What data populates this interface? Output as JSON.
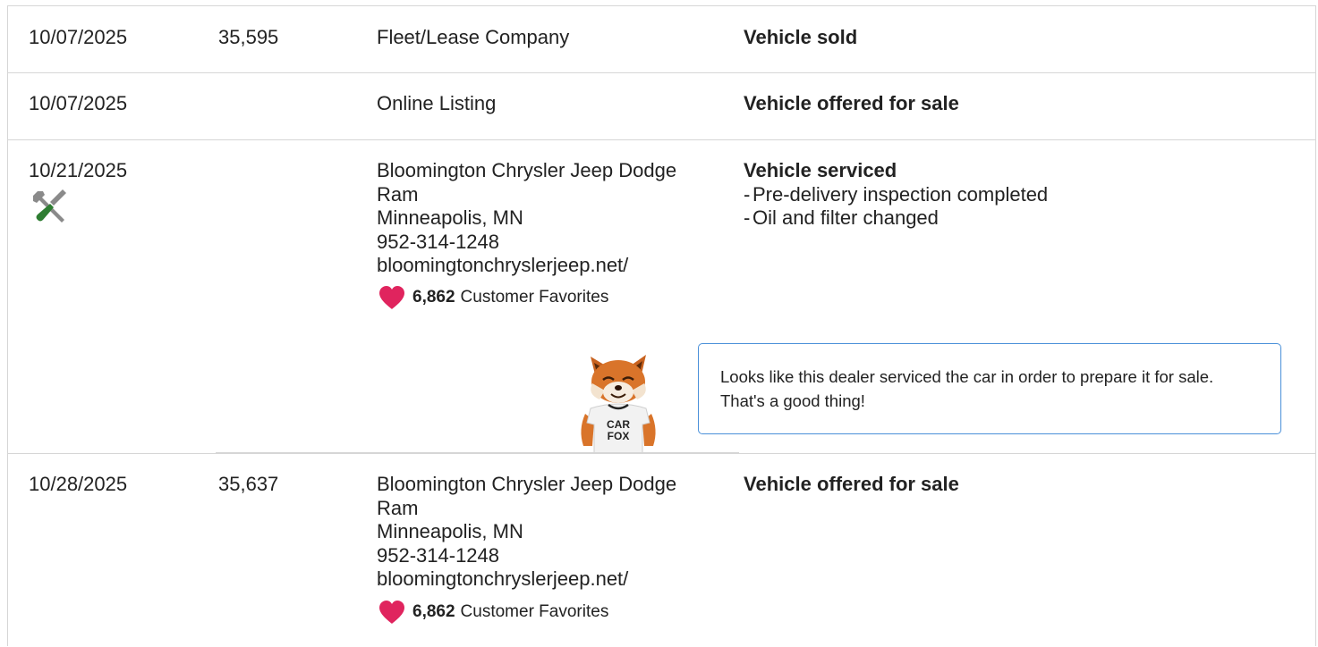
{
  "rows": [
    {
      "date": "10/07/2025",
      "odometer": "35,595",
      "source": [
        "Fleet/Lease Company"
      ],
      "comment_title": "Vehicle sold",
      "comment_bullets": []
    },
    {
      "date": "10/07/2025",
      "odometer": "",
      "source": [
        "Online Listing"
      ],
      "comment_title": "Vehicle offered for sale",
      "comment_bullets": []
    },
    {
      "date": "10/21/2025",
      "odometer": "",
      "icon": "wrench-screwdriver-icon",
      "source": [
        "Bloomington Chrysler Jeep Dodge",
        "Ram",
        "Minneapolis, MN",
        "952-314-1248",
        "bloomingtonchryslerjeep.net/"
      ],
      "favorites_count": "6,862",
      "favorites_label": "Customer Favorites",
      "comment_title": "Vehicle serviced",
      "comment_bullets": [
        "Pre-delivery inspection completed",
        "Oil and filter changed"
      ],
      "tip_text": "Looks like this dealer serviced the car in order to prepare it for sale. That's a good thing!",
      "mascot_shirt": [
        "CAR",
        "FOX"
      ]
    },
    {
      "date": "10/28/2025",
      "odometer": "35,637",
      "source": [
        "Bloomington Chrysler Jeep Dodge",
        "Ram",
        "Minneapolis, MN",
        "952-314-1248",
        "bloomingtonchryslerjeep.net/"
      ],
      "favorites_count": "6,862",
      "favorites_label": "Customer Favorites",
      "comment_title": "Vehicle offered for sale",
      "comment_bullets": []
    }
  ],
  "colors": {
    "border": "#d6d6d6",
    "heart": "#e0245e",
    "tip_border": "#4a90d9",
    "wrench_green": "#2e7d32"
  }
}
